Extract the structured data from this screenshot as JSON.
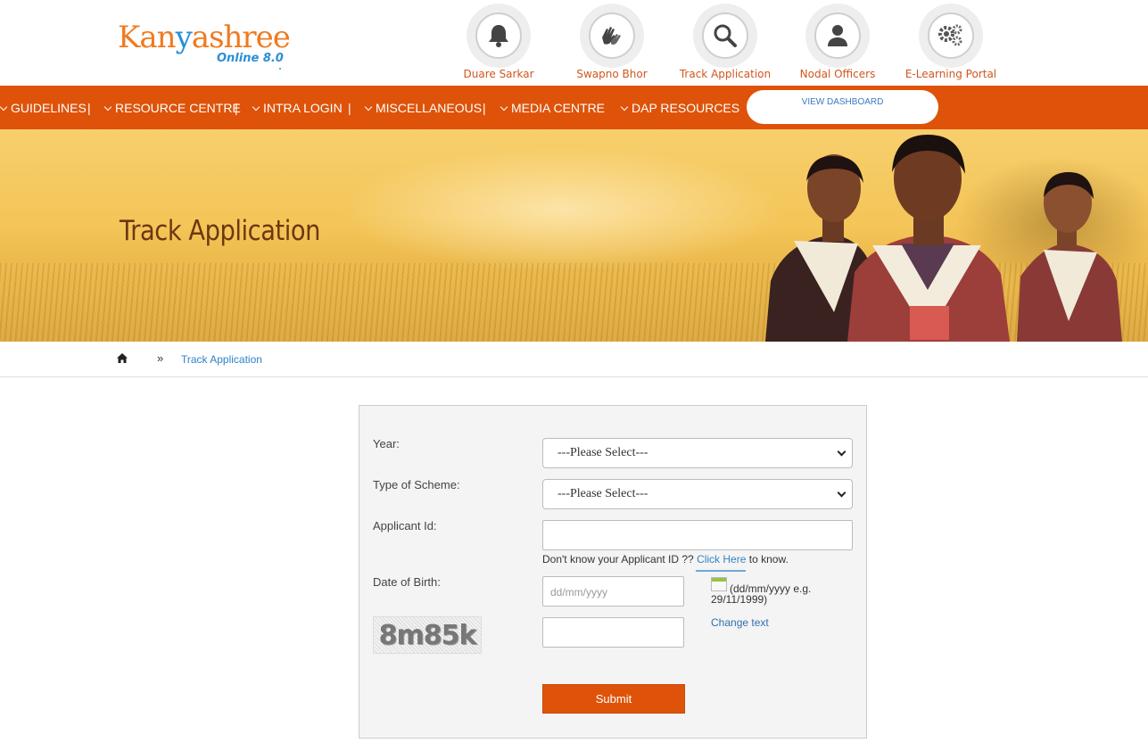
{
  "logo": {
    "brand_pre": "Kan",
    "brand_fig": "y",
    "brand_post": "ashree",
    "version": "Online 8.0"
  },
  "quick_links": [
    {
      "label": "Duare Sarkar",
      "icon": "bell-icon"
    },
    {
      "label": "Swapno Bhor",
      "icon": "hands-icon"
    },
    {
      "label": "Track Application",
      "icon": "search-icon"
    },
    {
      "label": "Nodal Officers",
      "icon": "user-icon"
    },
    {
      "label": "E-Learning Portal",
      "icon": "gears-icon"
    }
  ],
  "nav": {
    "items": [
      "GUIDELINES",
      "RESOURCE CENTRE",
      "INTRA LOGIN",
      "MISCELLANEOUS",
      "MEDIA CENTRE",
      "DAP RESOURCES"
    ],
    "separator": "|",
    "dashboard_label": "VIEW DASHBOARD"
  },
  "banner": {
    "title": "Track Application"
  },
  "breadcrumb": {
    "separator": "»",
    "current": "Track Application"
  },
  "form": {
    "year_label": "Year:",
    "year_value": "---Please Select---",
    "scheme_label": "Type of Scheme:",
    "scheme_value": "---Please Select---",
    "applicant_label": "Applicant Id:",
    "applicant_value": "",
    "hint_pre": "Don't know your Applicant ID ??",
    "hint_link": "Click Here",
    "hint_post": "to know.",
    "dob_label": "Date of Birth:",
    "dob_placeholder": "dd/mm/yyyy",
    "dob_hint_1": "(dd/mm/yyyy e.g.",
    "dob_hint_2": "29/11/1999)",
    "captcha_text": "8m85k",
    "change_text": "Change text",
    "submit_label": "Submit"
  },
  "colors": {
    "nav_bg": "#de5309",
    "link": "#2f83c6",
    "quick_label": "#d1561e",
    "banner_title": "#6b3810"
  }
}
